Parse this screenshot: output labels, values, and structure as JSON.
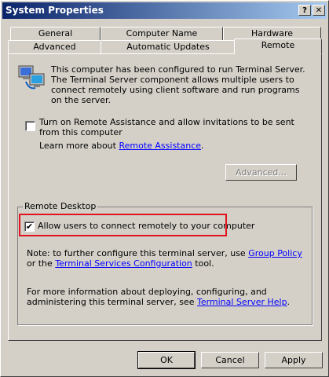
{
  "window": {
    "title": "System Properties"
  },
  "titlebar_buttons": {
    "help": "?",
    "close": "✕"
  },
  "tabs_row1": [
    "General",
    "Computer Name",
    "Hardware"
  ],
  "tabs_row2": [
    "Advanced",
    "Automatic Updates",
    "Remote"
  ],
  "active_tab": "Remote",
  "info": {
    "text": "This computer has been configured to run Terminal Server. The Terminal Server component allows multiple users to connect remotely using client software and run programs on the server.",
    "icon": "computers-icon"
  },
  "remote_assistance": {
    "checkbox_label": "Turn on Remote Assistance and allow invitations to be sent from this computer",
    "checked": false,
    "learn_more_prefix": "Learn more about",
    "learn_more_link": "Remote Assistance",
    "advanced_button": "Advanced..."
  },
  "remote_desktop": {
    "group_title": "Remote Desktop",
    "checkbox_label": "Allow users to connect remotely to your computer",
    "checked": true,
    "note_prefix": "Note: to further configure this terminal server, use",
    "group_policy_link": "Group Policy",
    "note_or": "or the",
    "tsc_link": "Terminal Services Configuration",
    "note_suffix": "tool.",
    "more_info_prefix": "For more information about deploying, configuring, and administering this terminal server, see",
    "help_link": "Terminal Server Help",
    "more_info_suffix": "."
  },
  "footer_buttons": {
    "ok": "OK",
    "cancel": "Cancel",
    "apply": "Apply"
  }
}
